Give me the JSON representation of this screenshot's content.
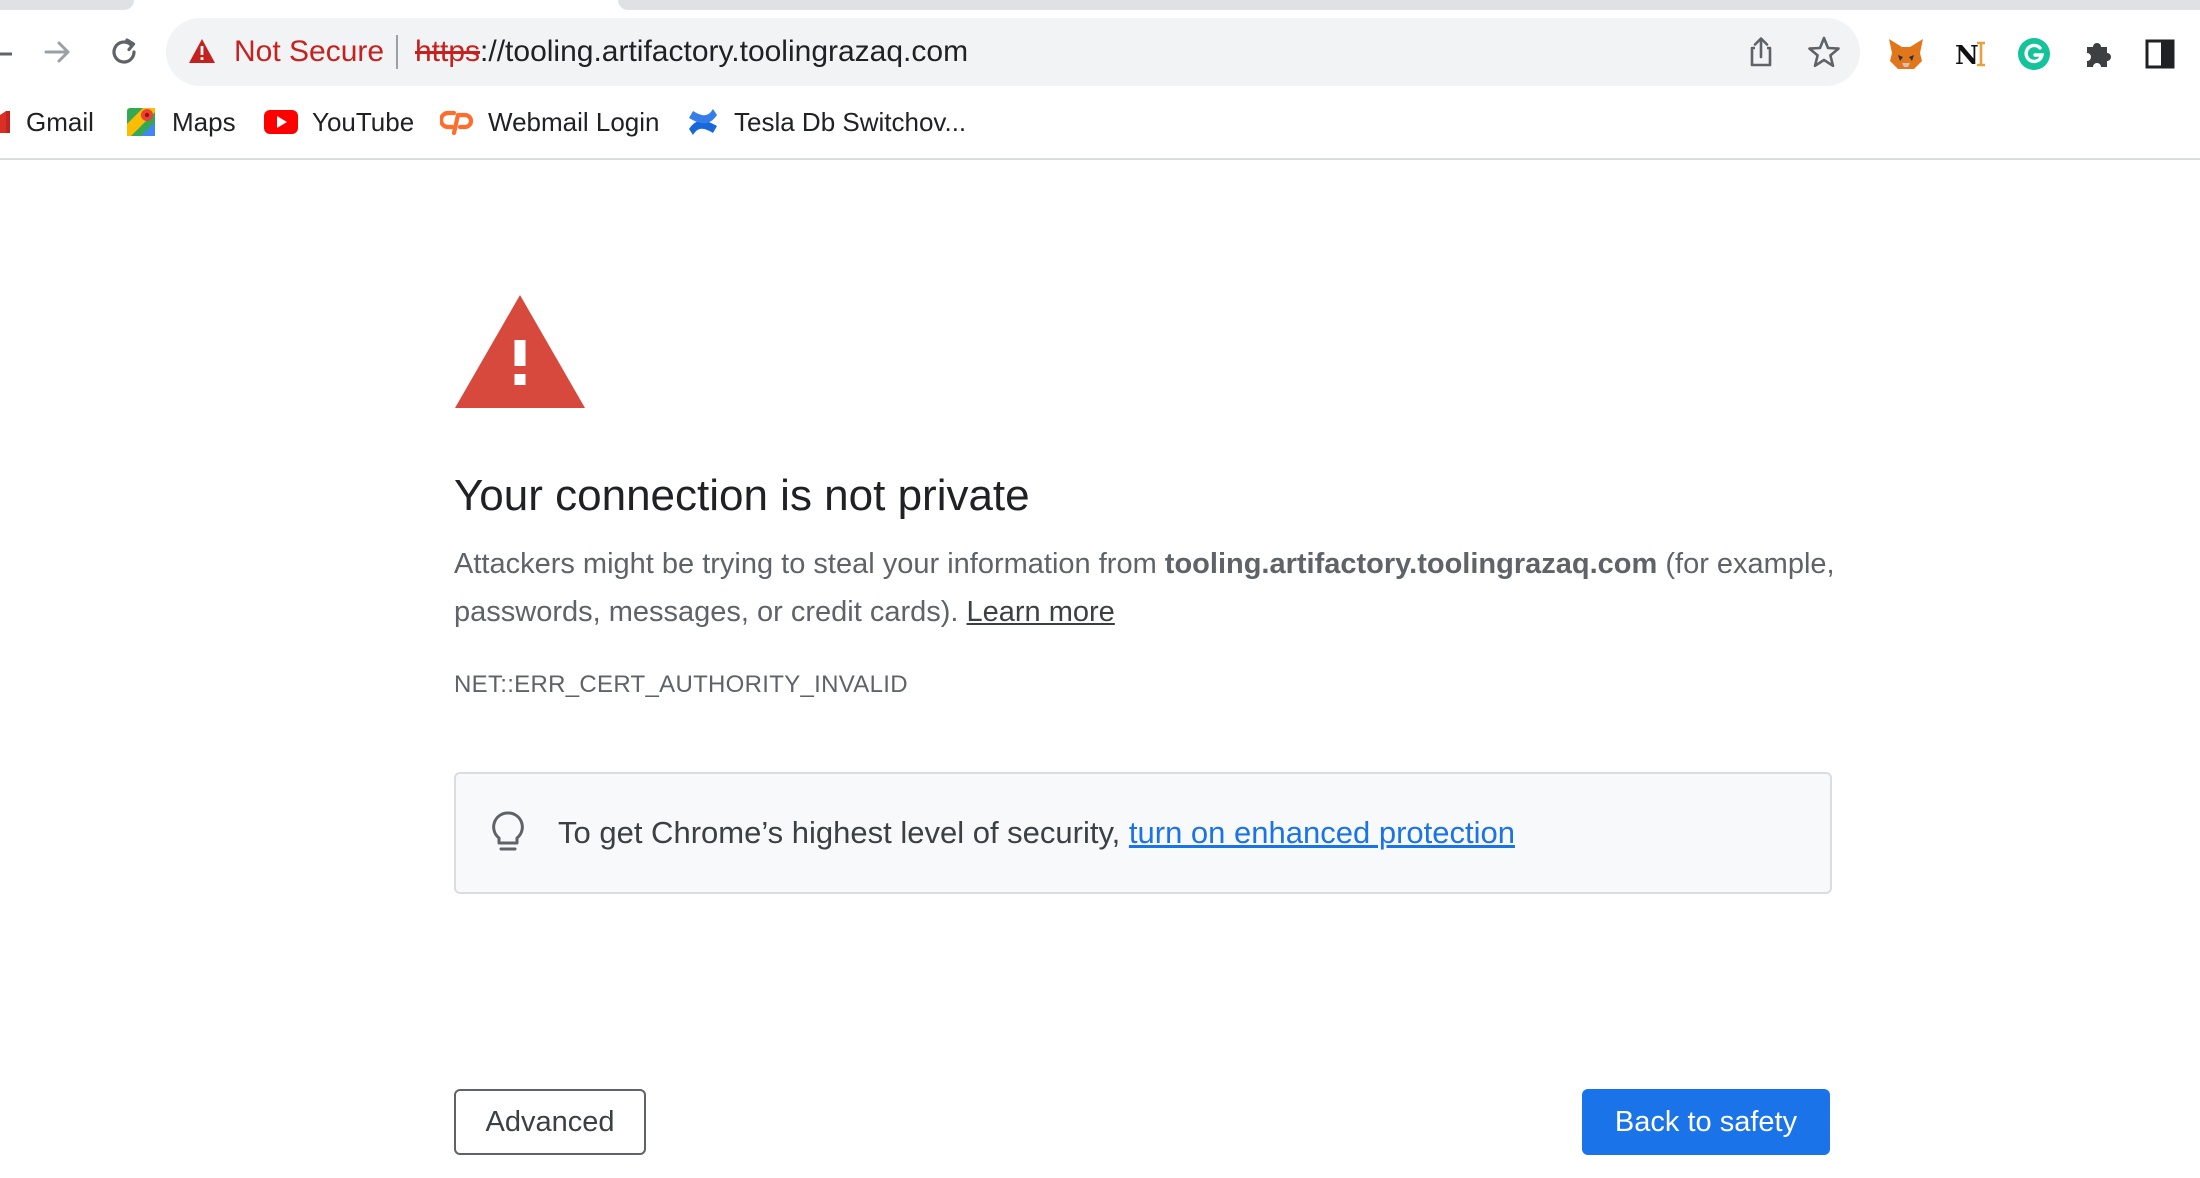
{
  "browser": {
    "security_label": "Not Secure",
    "url_scheme": "https",
    "url_rest": "://tooling.artifactory.toolingrazaq.com",
    "accent_color": "#1a73e8",
    "warning_color": "#c5221f"
  },
  "extensions": [
    {
      "name": "metamask-extension-icon"
    },
    {
      "name": "notion-web-clipper-extension-icon"
    },
    {
      "name": "grammarly-extension-icon"
    },
    {
      "name": "extensions-puzzle-icon"
    },
    {
      "name": "side-panel-icon"
    }
  ],
  "bookmarks": [
    {
      "label": "Gmail",
      "icon": "gmail-icon"
    },
    {
      "label": "Maps",
      "icon": "google-maps-icon"
    },
    {
      "label": "YouTube",
      "icon": "youtube-icon"
    },
    {
      "label": "Webmail Login",
      "icon": "cpanel-icon"
    },
    {
      "label": "Tesla Db Switchov...",
      "icon": "confluence-icon"
    }
  ],
  "interstitial": {
    "headline": "Your connection is not private",
    "body_prefix": "Attackers might be trying to steal your information from ",
    "body_host": "tooling.artifactory.toolingrazaq.com",
    "body_suffix": " (for example, passwords, messages, or credit cards). ",
    "learn_more": "Learn more",
    "error_code": "NET::ERR_CERT_AUTHORITY_INVALID",
    "enhanced_prefix": "To get Chrome’s highest level of security, ",
    "enhanced_link": "turn on enhanced protection",
    "advanced_button": "Advanced",
    "back_button": "Back to safety"
  }
}
